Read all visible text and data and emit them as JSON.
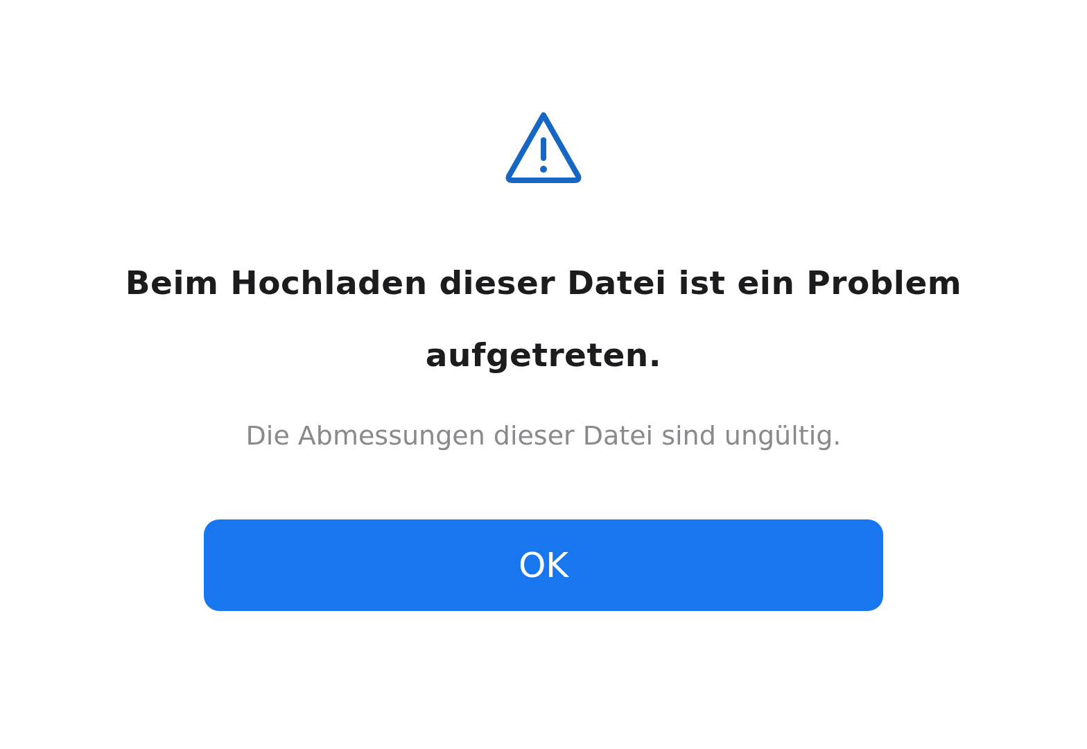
{
  "dialog": {
    "title": "Beim Hochladen dieser Datei ist ein Problem aufgetreten.",
    "message": "Die Abmessungen dieser Datei sind ungültig.",
    "buttons": [
      "OK"
    ]
  }
}
